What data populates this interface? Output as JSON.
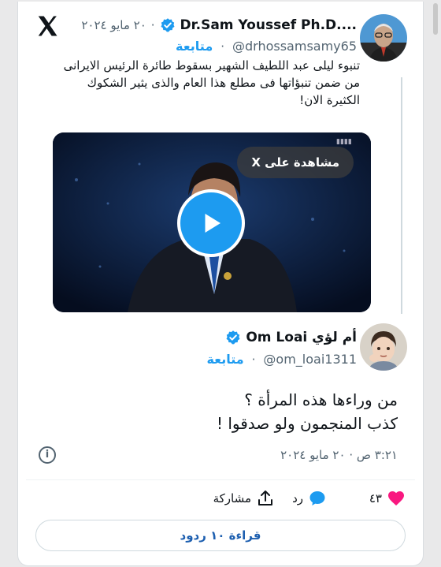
{
  "colors": {
    "accent": "#1d9bf0",
    "muted": "#536471",
    "heart": "#f91880",
    "verified": "#1d9bf0"
  },
  "main_tweet": {
    "author_name": "Dr.Sam Youssef Ph.D....",
    "handle": "@drhossamsamy65",
    "follow_label": "متابعة",
    "dot": "·",
    "date": "٢٠ مايو ٢٠٢٤",
    "text": "تنبوء ليلى عبد اللطيف الشهير بسقوط طائرة الرئيس الايرانى من ضمن تنبؤاتها فى مطلع هذا العام والذى يثير الشكوك الكثيرة الان!",
    "video": {
      "watch_label": "مشاهدة على X"
    }
  },
  "reply_tweet": {
    "author_name": "أم لؤي Om Loai",
    "handle": "@om_loai1311",
    "follow_label": "متابعة",
    "line1": "من وراءها هذه المرأة ؟",
    "line2": "كذب المنجمون ولو صدقوا !",
    "timestamp": "٣:٢١ ص · ٢٠ مايو ٢٠٢٤"
  },
  "actions": {
    "likes_count": "٤٣",
    "reply_label": "رد",
    "share_label": "مشاركة"
  },
  "read_replies_label": "قراءة ١٠ ردود",
  "icons": [
    "x-logo-icon",
    "verified-badge-icon",
    "play-icon",
    "info-icon",
    "heart-icon",
    "reply-bubble-icon",
    "share-icon"
  ]
}
